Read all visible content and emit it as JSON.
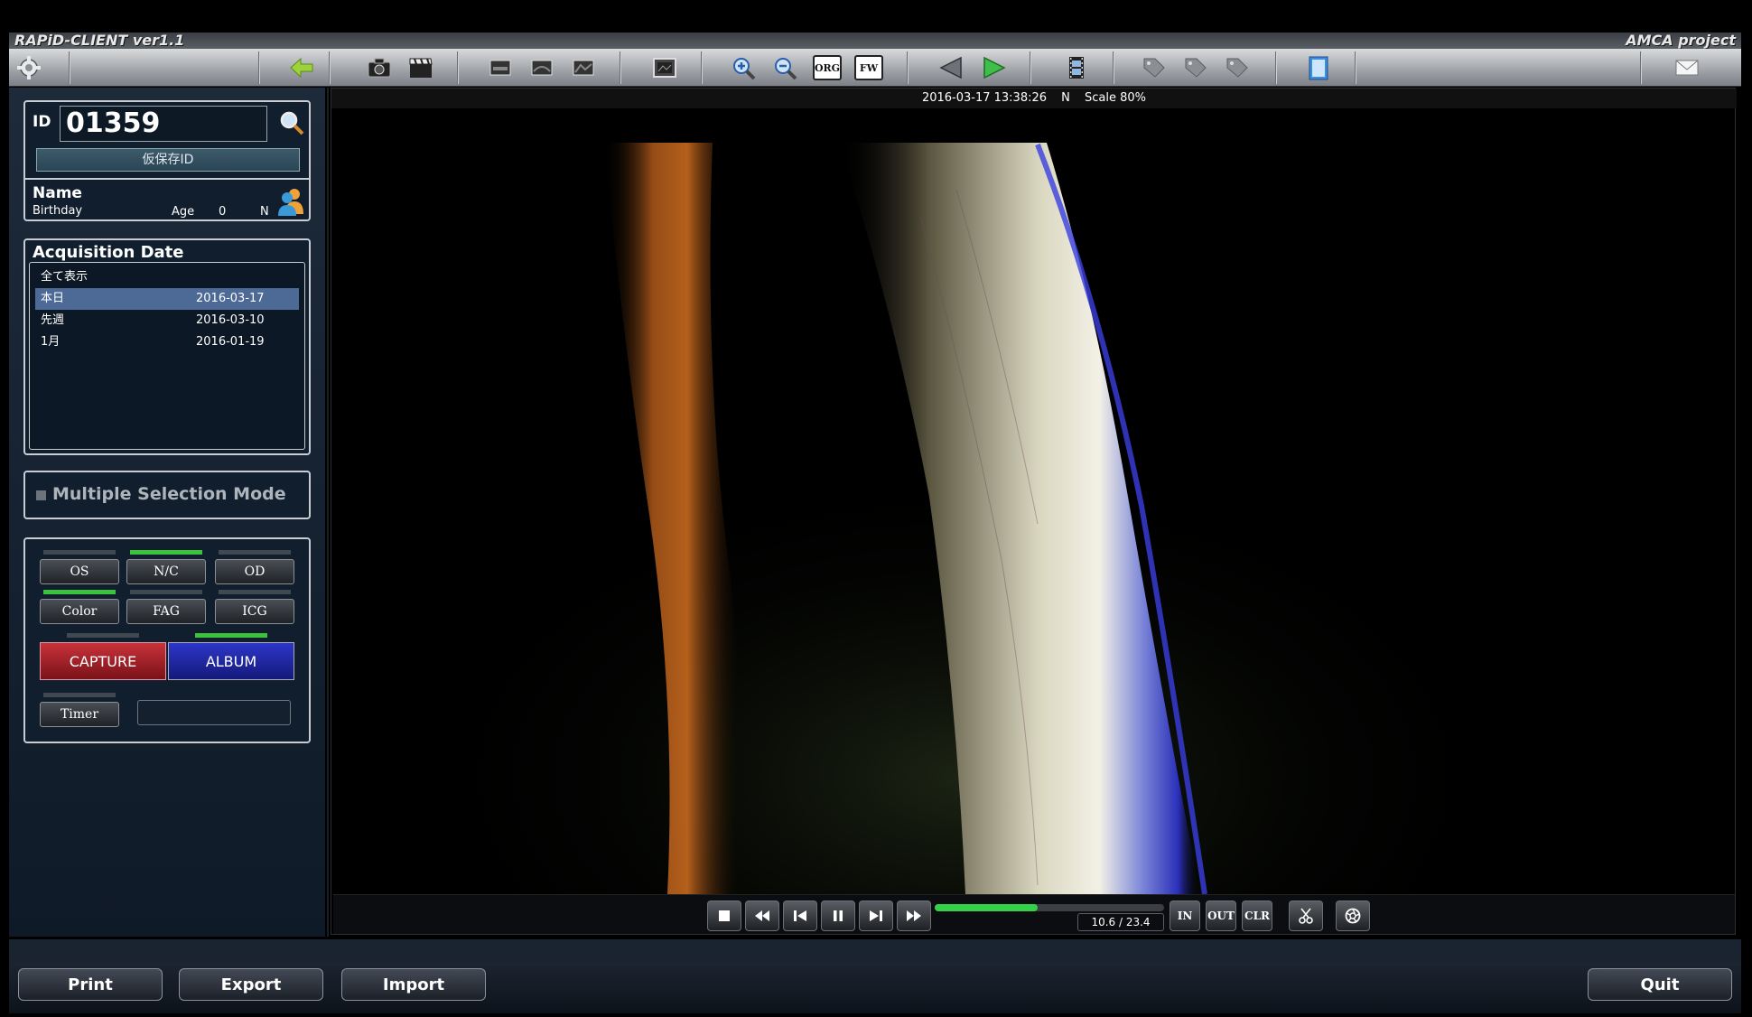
{
  "app": {
    "title": "RAPiD-CLIENT ver1.1",
    "project": "AMCA project"
  },
  "toolbar": {
    "icons": [
      "gear-icon",
      "back-arrow-icon",
      "camera-icon",
      "clapper-icon",
      "layout-single-icon",
      "layout-double-icon",
      "layout-triple-icon",
      "image-frame-icon",
      "zoom-in-icon",
      "zoom-out-icon",
      "org-icon",
      "fw-icon",
      "prev-icon",
      "next-icon",
      "filmstrip-icon",
      "tag-icon",
      "tag-icon",
      "tag-icon",
      "notebook-icon",
      "mail-icon"
    ],
    "org_label": "ORG",
    "fw_label": "FW"
  },
  "patient": {
    "id_label": "ID",
    "id_value": "01359",
    "temp_id": "仮保存ID",
    "name_label": "Name",
    "birthday_label": "Birthday",
    "age_label": "Age",
    "age_value": "0",
    "sex_value": "N"
  },
  "acquisition": {
    "title": "Acquisition Date",
    "items": [
      {
        "label": "全て表示",
        "date": ""
      },
      {
        "label": "本日",
        "date": "2016-03-17",
        "selected": true
      },
      {
        "label": "先週",
        "date": "2016-03-10"
      },
      {
        "label": "1月",
        "date": "2016-01-19"
      }
    ]
  },
  "multi_mode": {
    "label": "Multiple Selection Mode",
    "checked": false
  },
  "controls": {
    "os": "OS",
    "nc": "N/C",
    "od": "OD",
    "color": "Color",
    "fag": "FAG",
    "icg": "ICG",
    "capture": "CAPTURE",
    "album": "ALBUM",
    "timer": "Timer",
    "timer_value": "",
    "active": {
      "nc": true,
      "color": true,
      "album": true
    }
  },
  "viewer": {
    "timestamp": "2016-03-17 13:38:26",
    "sex": "N",
    "scale": "Scale 80%"
  },
  "player": {
    "in": "IN",
    "out": "OUT",
    "clr": "CLR",
    "time": "10.6 / 23.4",
    "progress": 0.45
  },
  "bottom": {
    "print": "Print",
    "export": "Export",
    "import": "Import",
    "quit": "Quit"
  },
  "colors": {
    "accent_green": "#3cc23c",
    "capture_red": "#c8323a",
    "album_blue": "#2d36c8",
    "selected_row": "#4d6a97"
  }
}
